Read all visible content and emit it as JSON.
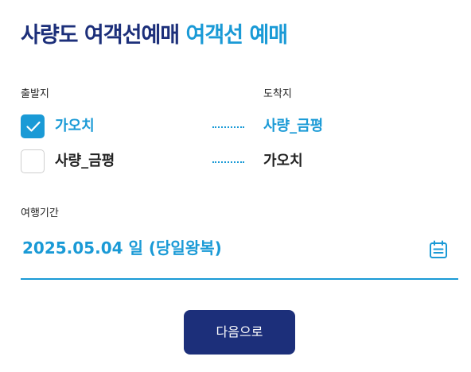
{
  "header": {
    "title_main": "사량도 여객선예매",
    "title_accent": "여객선 예매"
  },
  "route": {
    "origin_label": "출발지",
    "destination_label": "도착지",
    "options": [
      {
        "origin": "가오치",
        "destination": "사량_금평",
        "checked": true
      },
      {
        "origin": "사량_금평",
        "destination": "가오치",
        "checked": false
      }
    ]
  },
  "period": {
    "label": "여행기간",
    "value": "2025.05.04 일 (당일왕복)"
  },
  "actions": {
    "next_label": "다음으로"
  },
  "colors": {
    "brand_navy": "#1c2f7a",
    "accent_blue": "#1a9ad6"
  },
  "icons": {
    "check": "check-icon",
    "calendar": "calendar-icon"
  }
}
